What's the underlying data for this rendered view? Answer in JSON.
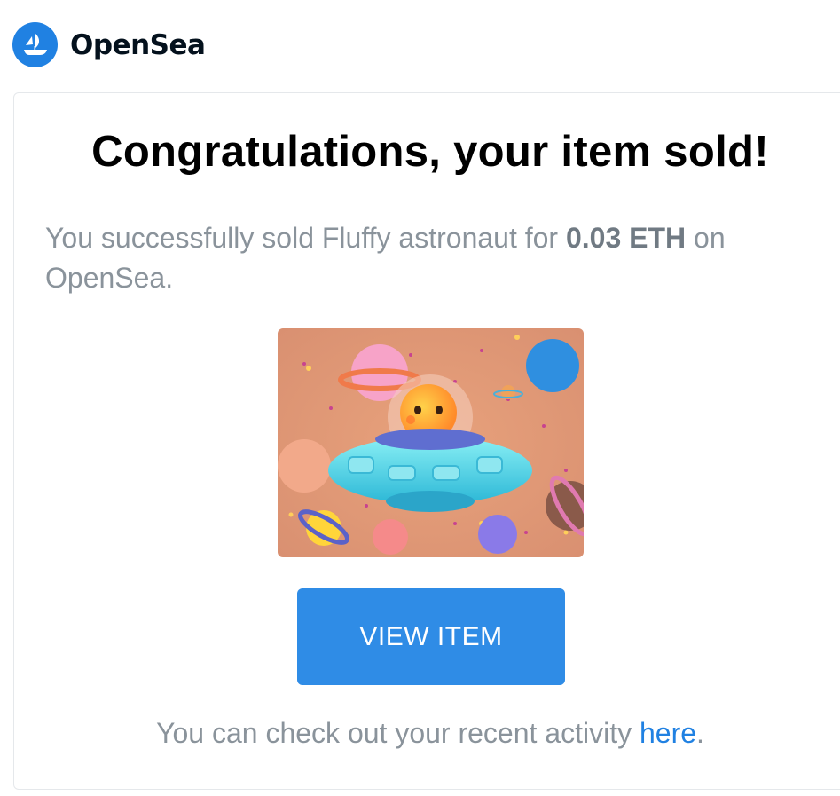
{
  "brand": {
    "name": "OpenSea",
    "logo_icon": "opensea-boat-icon",
    "color": "#2081e2"
  },
  "email": {
    "title": "Congratulations, your item sold!",
    "message_prefix": "You successfully sold Fluffy astronaut for ",
    "amount": "0.03 ETH",
    "message_suffix": " on OpenSea.",
    "item_image": "fluffy-astronaut-ufo-image",
    "button_label": "VIEW ITEM",
    "button_color": "#2f8ce6",
    "footer_prefix": "You can check out your recent activity ",
    "footer_link": "here",
    "footer_suffix": "."
  }
}
